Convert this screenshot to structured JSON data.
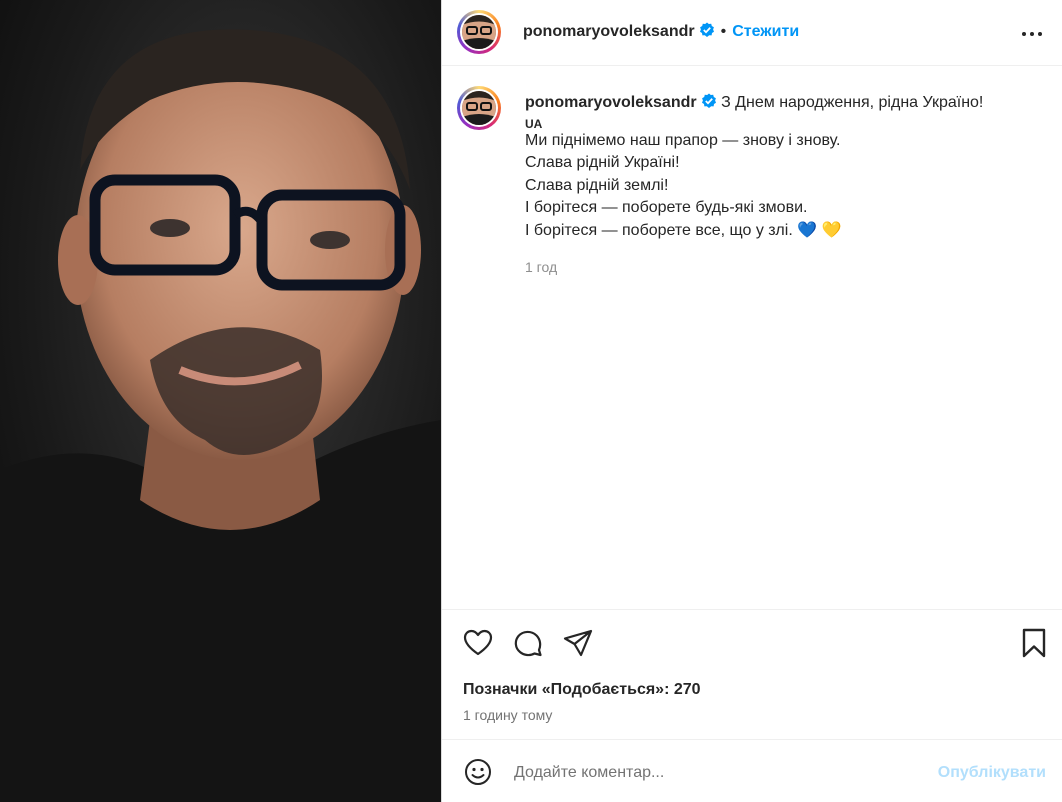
{
  "post": {
    "username": "ponomaryovoleksandr",
    "follow_label": "Стежити",
    "dot": "•"
  },
  "caption": {
    "username": "ponomaryovoleksandr",
    "first_line": "З Днем народження, рідна Україно!",
    "lang_tag": "UA",
    "lines": [
      "Ми піднімемо наш прапор — знову і знову.",
      "Слава рідній Україні!",
      "Слава рідній землі!",
      "І борітеся — поборете будь-які змови.",
      "І борітеся — поборете все, що у злі."
    ],
    "emojis": "💙 💛",
    "time": "1 год"
  },
  "stats": {
    "likes_text": "Позначки «Подобається»: 270",
    "time_ago": "1 годину тому"
  },
  "comment": {
    "placeholder": "Додайте коментар...",
    "publish_label": "Опублікувати"
  },
  "colors": {
    "accent": "#0095f6",
    "publish_disabled": "#b2dffc"
  },
  "icons": [
    "verified-badge-icon",
    "more-options-icon",
    "heart-icon",
    "comment-icon",
    "share-icon",
    "bookmark-icon",
    "emoji-icon"
  ]
}
